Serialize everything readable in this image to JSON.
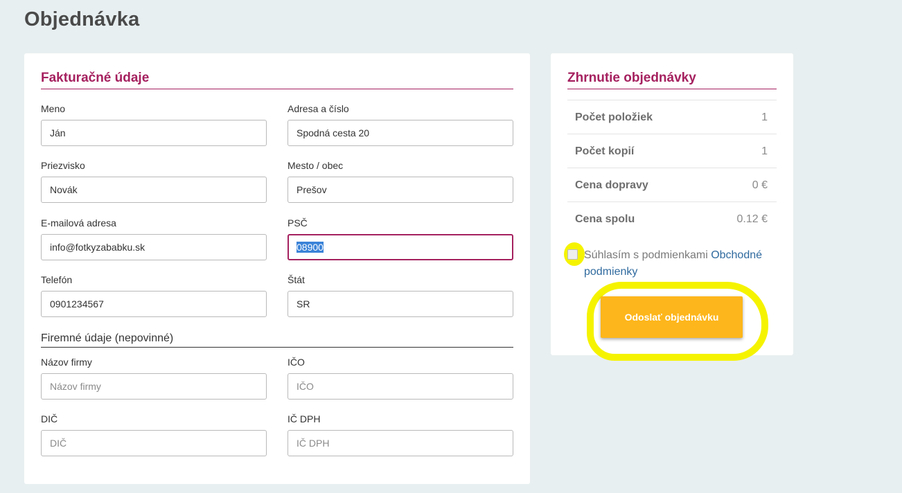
{
  "page": {
    "title": "Objednávka"
  },
  "billing": {
    "title": "Fakturačné údaje",
    "fields": {
      "first_name": {
        "label": "Meno",
        "value": "Ján"
      },
      "address": {
        "label": "Adresa a číslo",
        "value": "Spodná cesta 20"
      },
      "last_name": {
        "label": "Priezvisko",
        "value": "Novák"
      },
      "city": {
        "label": "Mesto / obec",
        "value": "Prešov"
      },
      "email": {
        "label": "E-mailová adresa",
        "value": "info@fotkyzababku.sk"
      },
      "zip": {
        "label": "PSČ",
        "value": "08900"
      },
      "phone": {
        "label": "Telefón",
        "value": "0901234567"
      },
      "country": {
        "label": "Štát",
        "value": "SR"
      }
    },
    "company": {
      "title": "Firemné údaje (nepovinné)",
      "fields": {
        "company_name": {
          "label": "Názov firmy",
          "placeholder": "Názov firmy",
          "value": ""
        },
        "ico": {
          "label": "IČO",
          "placeholder": "IČO",
          "value": ""
        },
        "dic": {
          "label": "DIČ",
          "placeholder": "DIČ",
          "value": ""
        },
        "ic_dph": {
          "label": "IČ DPH",
          "placeholder": "IČ DPH",
          "value": ""
        }
      }
    }
  },
  "summary": {
    "title": "Zhrnutie objednávky",
    "rows": [
      {
        "label": "Počet položiek",
        "value": "1"
      },
      {
        "label": "Počet kopií",
        "value": "1"
      },
      {
        "label": "Cena dopravy",
        "value": "0 €"
      },
      {
        "label": "Cena spolu",
        "value": "0.12 €"
      }
    ],
    "terms": {
      "text": "Súhlasím s podmienkami ",
      "link": "Obchodné podmienky"
    },
    "submit_label": "Odoslať objednávku"
  },
  "colors": {
    "accent": "#a5215f",
    "submit": "#fdb61b",
    "highlight": "#f5f300",
    "link": "#2f6a9e",
    "background": "#e8eff0"
  }
}
